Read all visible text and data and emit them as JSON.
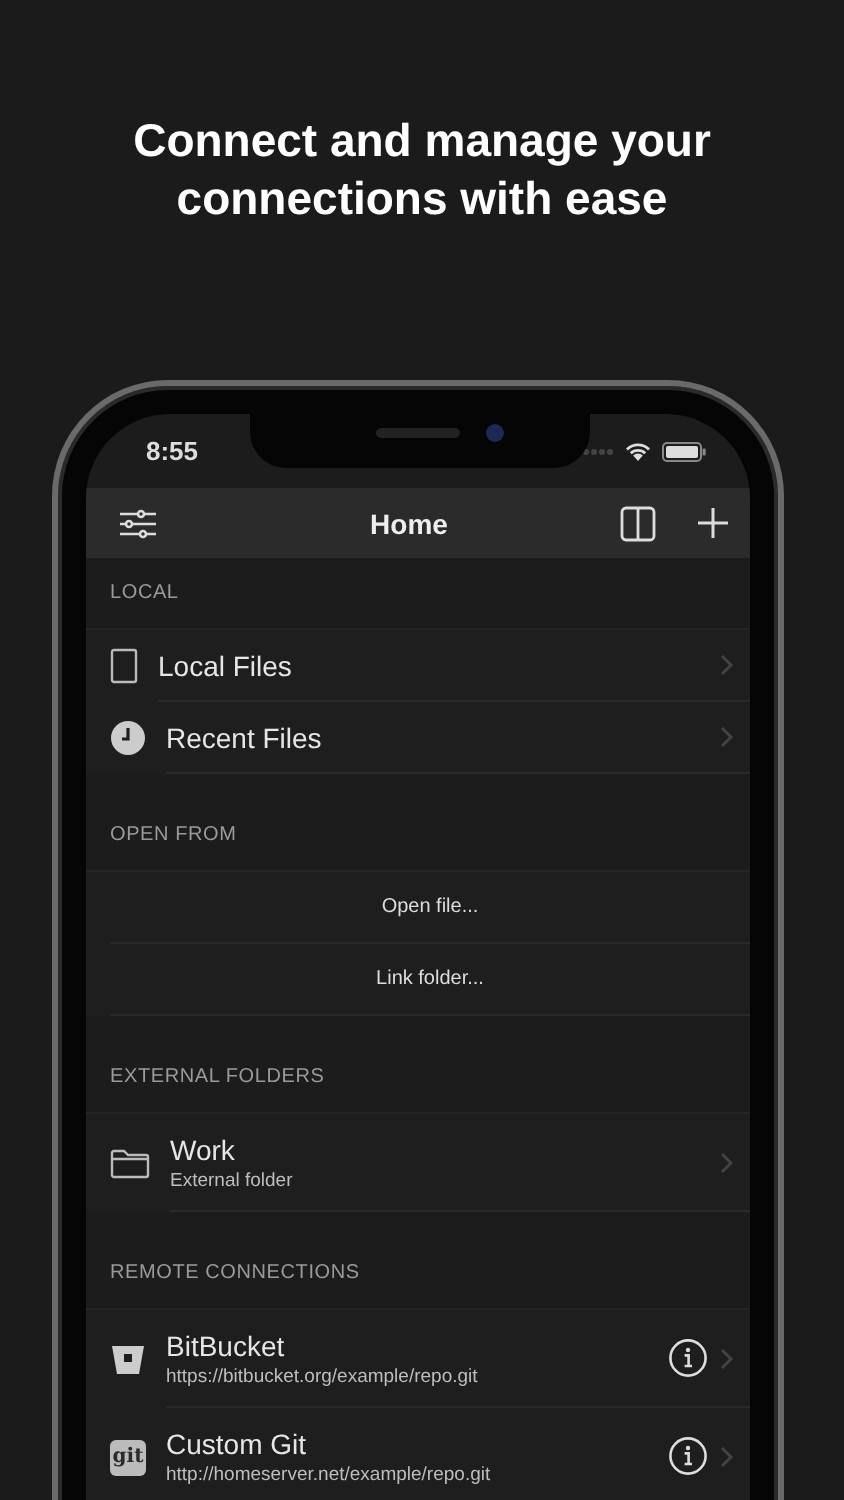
{
  "headline": "Connect and manage your connections with ease",
  "status_bar": {
    "time": "8:55"
  },
  "nav": {
    "title": "Home"
  },
  "sections": [
    {
      "title": "LOCAL",
      "items": [
        {
          "kind": "local",
          "label": "Local Files"
        },
        {
          "kind": "recent",
          "label": "Recent Files"
        }
      ]
    },
    {
      "title": "OPEN FROM",
      "items": [
        {
          "kind": "action",
          "label": "Open file..."
        },
        {
          "kind": "action",
          "label": "Link folder..."
        }
      ]
    },
    {
      "title": "EXTERNAL FOLDERS",
      "items": [
        {
          "kind": "folder",
          "label": "Work",
          "subtitle": "External folder"
        }
      ]
    },
    {
      "title": "REMOTE CONNECTIONS",
      "items": [
        {
          "kind": "bitbucket",
          "label": "BitBucket",
          "subtitle": "https://bitbucket.org/example/repo.git"
        },
        {
          "kind": "git",
          "label": "Custom Git",
          "subtitle": "http://homeserver.net/example/repo.git",
          "badge": "git"
        }
      ]
    }
  ]
}
